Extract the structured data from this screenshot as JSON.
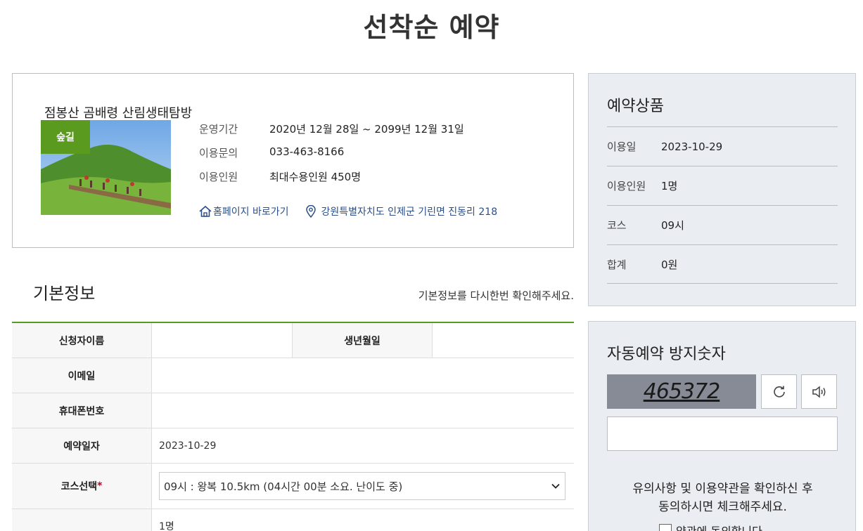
{
  "page": {
    "title": "선착순 예약"
  },
  "product": {
    "name": "점봉산 곰배령 산림생태탐방",
    "tag": "숲길",
    "info": [
      {
        "label": "운영기간",
        "value": "2020년 12월 28일 ~ 2099년 12월 31일"
      },
      {
        "label": "이용문의",
        "value": "033-463-8166"
      },
      {
        "label": "이용인원",
        "value": "최대수용인원 450명"
      }
    ],
    "homepage_link": "홈페이지 바로가기",
    "address_link": "강원특별자치도 인제군 기린면 진동리 218",
    "icons": {
      "home": "home-icon",
      "location": "map-pin-icon"
    },
    "accent_color": "#5a9a1f"
  },
  "basic_info": {
    "title": "기본정보",
    "note": "기본정보를 다시한번 확인해주세요.",
    "labels": {
      "applicant_name": "신청자이름",
      "birth_date": "생년월일",
      "email": "이메일",
      "mobile": "휴대폰번호",
      "reservation_date": "예약일자",
      "course_select": "코스선택",
      "required_mark": "*"
    },
    "values": {
      "reservation_date": "2023-10-29",
      "course_select": "09시 : 왕복 10.5km (04시간 00분 소요. 난이도 중)",
      "people": "1명"
    }
  },
  "reservation_product": {
    "title": "예약상품",
    "rows": [
      {
        "label": "이용일",
        "value": "2023-10-29"
      },
      {
        "label": "이용인원",
        "value": "1명"
      },
      {
        "label": "코스",
        "value": "09시"
      },
      {
        "label": "합계",
        "value": "0원"
      }
    ]
  },
  "captcha": {
    "title": "자동예약 방지숫자",
    "code": "465372",
    "refresh_icon": "refresh-icon",
    "audio_icon": "speaker-icon",
    "input_value": "",
    "note_line1": "유의사항 및 이용약관을 확인하신 후",
    "note_line2": "동의하시면 체크해주세요.",
    "agree_label": "약관에 동의합니다."
  }
}
